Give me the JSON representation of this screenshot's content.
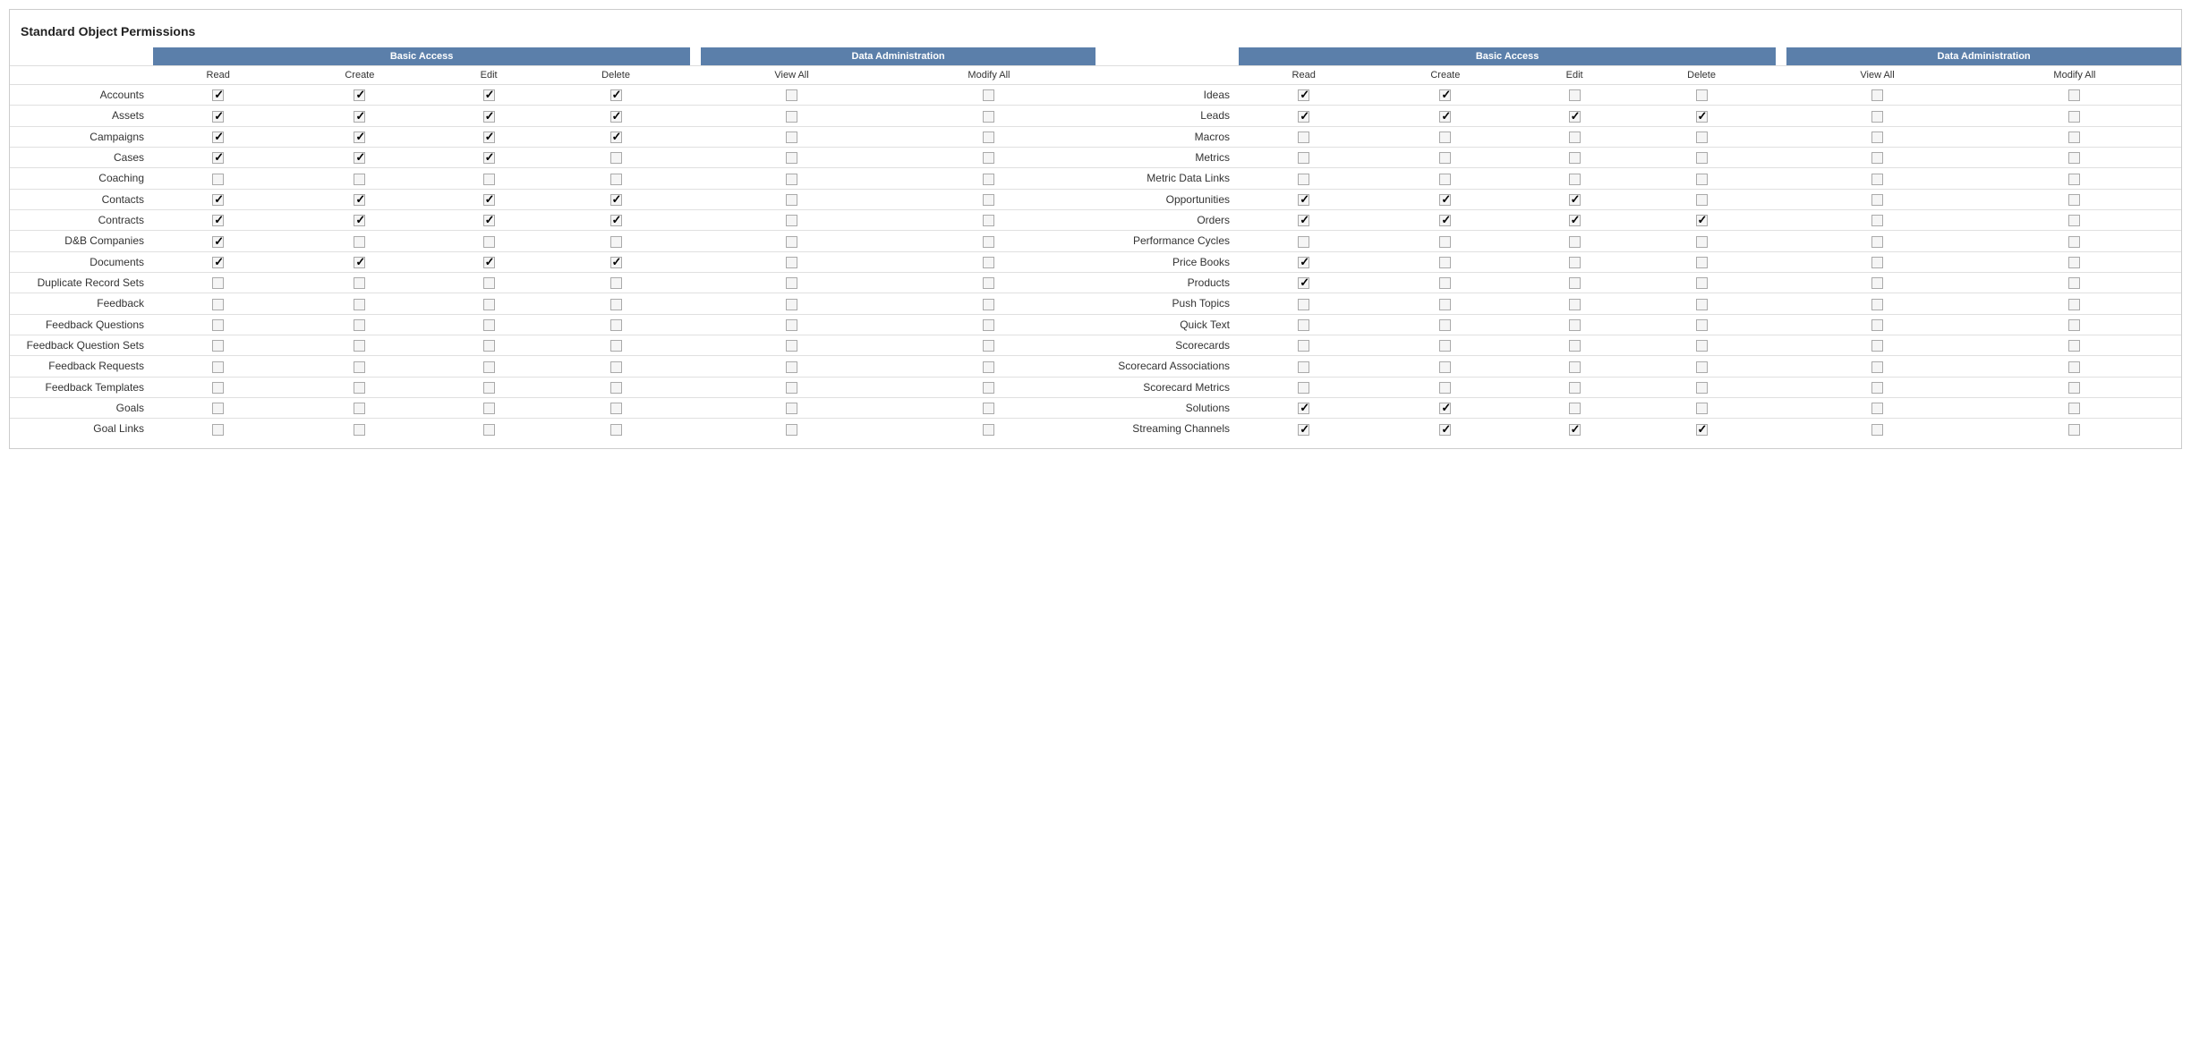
{
  "title": "Standard Object Permissions",
  "columns": {
    "basic_access": "Basic Access",
    "data_administration": "Data Administration",
    "read": "Read",
    "create": "Create",
    "edit": "Edit",
    "delete": "Delete",
    "view_all": "View All",
    "modify_all": "Modify All"
  },
  "left_objects": [
    {
      "name": "Accounts",
      "read": true,
      "create": true,
      "edit": true,
      "delete": true,
      "view_all": false,
      "modify_all": false
    },
    {
      "name": "Assets",
      "read": true,
      "create": true,
      "edit": true,
      "delete": true,
      "view_all": false,
      "modify_all": false
    },
    {
      "name": "Campaigns",
      "read": true,
      "create": true,
      "edit": true,
      "delete": true,
      "view_all": false,
      "modify_all": false
    },
    {
      "name": "Cases",
      "read": true,
      "create": true,
      "edit": true,
      "delete": false,
      "view_all": false,
      "modify_all": false
    },
    {
      "name": "Coaching",
      "read": false,
      "create": false,
      "edit": false,
      "delete": false,
      "view_all": false,
      "modify_all": false
    },
    {
      "name": "Contacts",
      "read": true,
      "create": true,
      "edit": true,
      "delete": true,
      "view_all": false,
      "modify_all": false
    },
    {
      "name": "Contracts",
      "read": true,
      "create": true,
      "edit": true,
      "delete": true,
      "view_all": false,
      "modify_all": false
    },
    {
      "name": "D&B Companies",
      "read": true,
      "create": false,
      "edit": false,
      "delete": false,
      "view_all": false,
      "modify_all": false
    },
    {
      "name": "Documents",
      "read": true,
      "create": true,
      "edit": true,
      "delete": true,
      "view_all": false,
      "modify_all": false
    },
    {
      "name": "Duplicate Record Sets",
      "read": false,
      "create": false,
      "edit": false,
      "delete": false,
      "view_all": false,
      "modify_all": false
    },
    {
      "name": "Feedback",
      "read": false,
      "create": false,
      "edit": false,
      "delete": false,
      "view_all": false,
      "modify_all": false
    },
    {
      "name": "Feedback Questions",
      "read": false,
      "create": false,
      "edit": false,
      "delete": false,
      "view_all": false,
      "modify_all": false
    },
    {
      "name": "Feedback Question Sets",
      "read": false,
      "create": false,
      "edit": false,
      "delete": false,
      "view_all": false,
      "modify_all": false
    },
    {
      "name": "Feedback Requests",
      "read": false,
      "create": false,
      "edit": false,
      "delete": false,
      "view_all": false,
      "modify_all": false
    },
    {
      "name": "Feedback Templates",
      "read": false,
      "create": false,
      "edit": false,
      "delete": false,
      "view_all": false,
      "modify_all": false
    },
    {
      "name": "Goals",
      "read": false,
      "create": false,
      "edit": false,
      "delete": false,
      "view_all": false,
      "modify_all": false
    },
    {
      "name": "Goal Links",
      "read": false,
      "create": false,
      "edit": false,
      "delete": false,
      "view_all": false,
      "modify_all": false
    }
  ],
  "right_objects": [
    {
      "name": "Ideas",
      "read": true,
      "create": true,
      "edit": false,
      "delete": false,
      "view_all": false,
      "modify_all": false
    },
    {
      "name": "Leads",
      "read": true,
      "create": true,
      "edit": true,
      "delete": true,
      "view_all": false,
      "modify_all": false
    },
    {
      "name": "Macros",
      "read": false,
      "create": false,
      "edit": false,
      "delete": false,
      "view_all": false,
      "modify_all": false
    },
    {
      "name": "Metrics",
      "read": false,
      "create": false,
      "edit": false,
      "delete": false,
      "view_all": false,
      "modify_all": false
    },
    {
      "name": "Metric Data Links",
      "read": false,
      "create": false,
      "edit": false,
      "delete": false,
      "view_all": false,
      "modify_all": false
    },
    {
      "name": "Opportunities",
      "read": true,
      "create": true,
      "edit": true,
      "delete": false,
      "view_all": false,
      "modify_all": false
    },
    {
      "name": "Orders",
      "read": true,
      "create": true,
      "edit": true,
      "delete": true,
      "view_all": false,
      "modify_all": false
    },
    {
      "name": "Performance Cycles",
      "read": false,
      "create": false,
      "edit": false,
      "delete": false,
      "view_all": false,
      "modify_all": false
    },
    {
      "name": "Price Books",
      "read": true,
      "create": false,
      "edit": false,
      "delete": false,
      "view_all": false,
      "modify_all": false
    },
    {
      "name": "Products",
      "read": true,
      "create": false,
      "edit": false,
      "delete": false,
      "view_all": false,
      "modify_all": false
    },
    {
      "name": "Push Topics",
      "read": false,
      "create": false,
      "edit": false,
      "delete": false,
      "view_all": false,
      "modify_all": false
    },
    {
      "name": "Quick Text",
      "read": false,
      "create": false,
      "edit": false,
      "delete": false,
      "view_all": false,
      "modify_all": false
    },
    {
      "name": "Scorecards",
      "read": false,
      "create": false,
      "edit": false,
      "delete": false,
      "view_all": false,
      "modify_all": false
    },
    {
      "name": "Scorecard Associations",
      "read": false,
      "create": false,
      "edit": false,
      "delete": false,
      "view_all": false,
      "modify_all": false
    },
    {
      "name": "Scorecard Metrics",
      "read": false,
      "create": false,
      "edit": false,
      "delete": false,
      "view_all": false,
      "modify_all": false
    },
    {
      "name": "Solutions",
      "read": true,
      "create": true,
      "edit": false,
      "delete": false,
      "view_all": false,
      "modify_all": false
    },
    {
      "name": "Streaming Channels",
      "read": true,
      "create": true,
      "edit": true,
      "delete": true,
      "view_all": false,
      "modify_all": false
    }
  ]
}
